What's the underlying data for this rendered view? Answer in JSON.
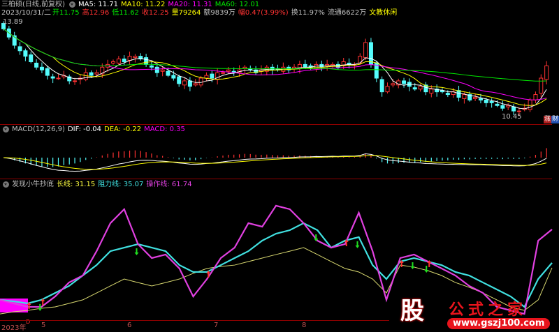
{
  "header": {
    "stock_name": "三柏硕(日线,前复权)",
    "ma5": "MA5: 11.71",
    "ma10": "MA10: 11.22",
    "ma20": "MA20: 11.31",
    "ma60": "MA60: 12.01",
    "date": "2023/10/31/二",
    "open": "开11.75",
    "high": "高12.96",
    "low": "低11.62",
    "close": "收12.25",
    "volume": "量79264",
    "amount": "额9839万",
    "change": "幅0.47(3.99%)",
    "turnover": "换11.97%",
    "float": "流通6622万",
    "sector": "文教休闲"
  },
  "main": {
    "max_label": "13.89",
    "min_label": "10.45",
    "badge_up": "涨",
    "badge_cai": "财"
  },
  "macd": {
    "title": "MACD(12,26,9)",
    "dif": "DIF: -0.04",
    "dea": "DEA: -0.22",
    "macd": "MACD: 0.35"
  },
  "indicator": {
    "title": "发现小牛抄底",
    "long": "长线: 31.15",
    "resist": "阻力线: 35.07",
    "op": "操作线: 61.74",
    "marker": "D"
  },
  "axis": {
    "labels": [
      "2023年",
      "5",
      "6",
      "7",
      "8"
    ]
  },
  "logo": {
    "char": "股",
    "name": "公式之家",
    "url": "www.gszj100.com"
  },
  "colors": {
    "up": "#ff3232",
    "down": "#54fcfc",
    "ma5": "#ffffff",
    "ma10": "#ffff00",
    "ma20": "#ff00ff",
    "ma60": "#00e600",
    "op": "#e040e0",
    "resist": "#40e0e0",
    "long": "#d8d870"
  },
  "chart_data": {
    "type": "line",
    "price": {
      "closes": [
        13.6,
        13.3,
        13.0,
        12.8,
        12.6,
        12.4,
        12.2,
        12.1,
        11.9,
        11.8,
        11.8,
        11.9,
        11.7,
        11.7,
        11.8,
        12.0,
        11.9,
        12.0,
        12.2,
        12.3,
        12.4,
        12.5,
        12.4,
        12.6,
        12.6,
        12.5,
        12.3,
        12.2,
        12.0,
        12.1,
        11.9,
        11.8,
        11.6,
        11.7,
        11.5,
        11.6,
        11.8,
        11.9,
        11.8,
        12.0,
        12.0,
        12.1,
        12.0,
        12.1,
        12.2,
        12.1,
        12.0,
        12.1,
        12.2,
        12.1,
        12.1,
        12.2,
        12.1,
        12.2,
        12.3,
        12.2,
        12.2,
        12.3,
        12.2,
        12.3,
        12.3,
        12.2,
        12.4,
        12.3,
        12.3,
        12.6,
        13.1,
        12.3,
        11.8,
        11.3,
        11.5,
        11.6,
        11.7,
        11.6,
        11.5,
        11.4,
        11.5,
        11.3,
        11.4,
        11.3,
        11.3,
        11.2,
        11.3,
        11.1,
        11.2,
        11.0,
        11.1,
        11.0,
        10.9,
        10.9,
        10.8,
        10.7,
        10.8,
        10.6,
        10.6,
        10.7,
        11.0,
        11.2,
        11.8,
        12.25
      ],
      "ylim": [
        10.45,
        13.89
      ]
    },
    "indicator": {
      "ylim": [
        -10,
        100
      ],
      "op_line": [
        5.6,
        2.8,
        0,
        0,
        8.3,
        19.4,
        25,
        44.4,
        66.7,
        77.8,
        50,
        38.9,
        41.7,
        30.6,
        8.3,
        22.2,
        38.9,
        47.2,
        66.7,
        63.9,
        80.6,
        77.8,
        66.7,
        52.8,
        47.2,
        50,
        75,
        44.4,
        5.6,
        38.9,
        41.7,
        36.1,
        30.6,
        25,
        16.7,
        11.1,
        0,
        -2.8,
        -5.6,
        52.8,
        61.74
      ],
      "resist_line": [
        5.6,
        4.4,
        2.8,
        5.6,
        11.1,
        16.7,
        25,
        33.3,
        44.4,
        47.2,
        50,
        47.2,
        44.4,
        33.3,
        27.8,
        27.8,
        33.3,
        38.9,
        44.4,
        52.8,
        58.3,
        61.1,
        66.7,
        61.1,
        47.2,
        52.8,
        55.6,
        33.3,
        22.2,
        36.1,
        38.9,
        36.1,
        33.3,
        27.8,
        25,
        19.4,
        13.9,
        8.3,
        0,
        22.2,
        35.07
      ],
      "long_line": [
        -5.6,
        -3.9,
        -2.8,
        -1.1,
        0,
        2.8,
        5.6,
        11.1,
        16.7,
        22.2,
        19.4,
        16.7,
        19.4,
        22.2,
        26.7,
        30.6,
        32.2,
        33.3,
        36.1,
        38.9,
        41.7,
        44.4,
        47.2,
        41.7,
        36.1,
        30.6,
        27.8,
        22.2,
        11.1,
        33.3,
        31.7,
        28.9,
        25,
        19.4,
        15.6,
        11.1,
        5.6,
        0,
        -2.8,
        5.6,
        31.15
      ],
      "buy_signals": [
        2,
        3,
        15,
        25,
        29,
        31
      ],
      "sell_signals": [
        3,
        10,
        23,
        26,
        30,
        31
      ]
    }
  }
}
